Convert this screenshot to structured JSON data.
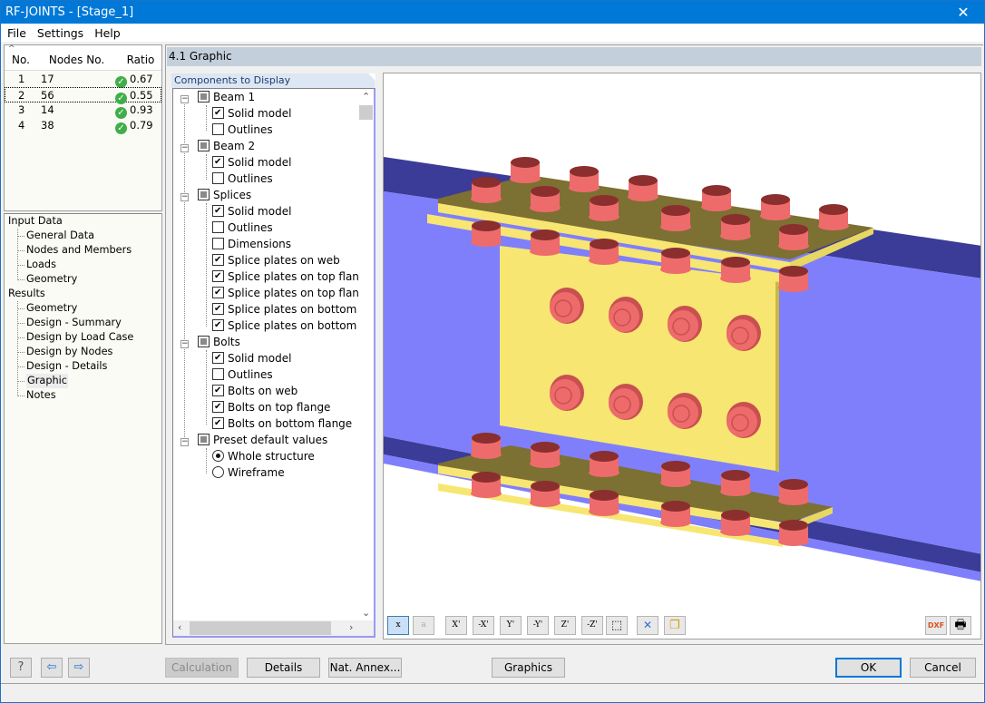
{
  "window": {
    "title": "RF-JOINTS - [Stage_1]",
    "close_label": "✕"
  },
  "menu": [
    "File",
    "Settings",
    "Help"
  ],
  "nodes_table": {
    "columns": [
      "No.",
      "Nodes No.",
      "Ratio"
    ],
    "rows": [
      {
        "no": "1",
        "node": "17",
        "ratio": "0.67",
        "status": "ok"
      },
      {
        "no": "2",
        "node": "56",
        "ratio": "0.55",
        "status": "ok"
      },
      {
        "no": "3",
        "node": "14",
        "ratio": "0.93",
        "status": "ok"
      },
      {
        "no": "4",
        "node": "38",
        "ratio": "0.79",
        "status": "ok"
      }
    ],
    "selected_row": 2
  },
  "navigation": {
    "input_data": {
      "label": "Input Data",
      "items": [
        "General Data",
        "Nodes and Members",
        "Loads",
        "Geometry"
      ]
    },
    "results": {
      "label": "Results",
      "items": [
        "Geometry",
        "Design - Summary",
        "Design by Load Case",
        "Design by Nodes",
        "Design - Details",
        "Graphic",
        "Notes"
      ]
    },
    "current": "Graphic"
  },
  "section": {
    "title": "4.1 Graphic"
  },
  "components": {
    "title": "Components to Display",
    "groups": [
      {
        "label": "Beam 1",
        "items": [
          {
            "label": "Solid model",
            "checked": true
          },
          {
            "label": "Outlines",
            "checked": false
          }
        ]
      },
      {
        "label": "Beam 2",
        "items": [
          {
            "label": "Solid model",
            "checked": true
          },
          {
            "label": "Outlines",
            "checked": false
          }
        ]
      },
      {
        "label": "Splices",
        "items": [
          {
            "label": "Solid model",
            "checked": true
          },
          {
            "label": "Outlines",
            "checked": false
          },
          {
            "label": "Dimensions",
            "checked": false
          },
          {
            "label": "Splice plates on web",
            "checked": true
          },
          {
            "label": "Splice plates on top flange",
            "checked": true
          },
          {
            "label": "Splice plates on top flange",
            "checked": true
          },
          {
            "label": "Splice plates on bottom flange",
            "checked": true
          },
          {
            "label": "Splice plates on bottom flange",
            "checked": true
          }
        ]
      },
      {
        "label": "Bolts",
        "items": [
          {
            "label": "Solid model",
            "checked": true
          },
          {
            "label": "Outlines",
            "checked": false
          },
          {
            "label": "Bolts on web",
            "checked": true
          },
          {
            "label": "Bolts on top flange",
            "checked": true
          },
          {
            "label": "Bolts on bottom flange",
            "checked": true
          }
        ]
      },
      {
        "label": "Preset default values",
        "radio": true,
        "items": [
          {
            "label": "Whole structure",
            "checked": true
          },
          {
            "label": "Wireframe",
            "checked": false
          }
        ]
      }
    ]
  },
  "view_toolbar": {
    "buttons": [
      {
        "name": "show-dimensions-x",
        "label": "x",
        "active": true
      },
      {
        "name": "show-dimensions-a",
        "label": "a",
        "active": false
      },
      {
        "name": "view-x",
        "label": "X'"
      },
      {
        "name": "view-minus-x",
        "label": "-X'"
      },
      {
        "name": "view-y",
        "label": "Y'"
      },
      {
        "name": "view-minus-y",
        "label": "-Y'"
      },
      {
        "name": "view-z",
        "label": "Z'"
      },
      {
        "name": "view-minus-z",
        "label": "-Z'"
      },
      {
        "name": "isometric-view",
        "label": "⬚"
      },
      {
        "name": "zoom-reset",
        "label": "✕"
      },
      {
        "name": "copy-view",
        "label": "❐"
      }
    ],
    "export_dxf": "DXF",
    "print": "🖶"
  },
  "bottom_buttons": {
    "calculation": "Calculation",
    "details": "Details",
    "nat_annex": "Nat. Annex...",
    "graphics": "Graphics",
    "ok": "OK",
    "cancel": "Cancel"
  },
  "colors": {
    "beam_web": "#7f7ffc",
    "beam_flange_dark": "#3b3b98",
    "plate": "#f7e672",
    "plate_top": "#7c7033",
    "bolt": "#ee6b6b",
    "bolt_dark": "#8b2e2e",
    "title_bar": "#0078d7"
  }
}
